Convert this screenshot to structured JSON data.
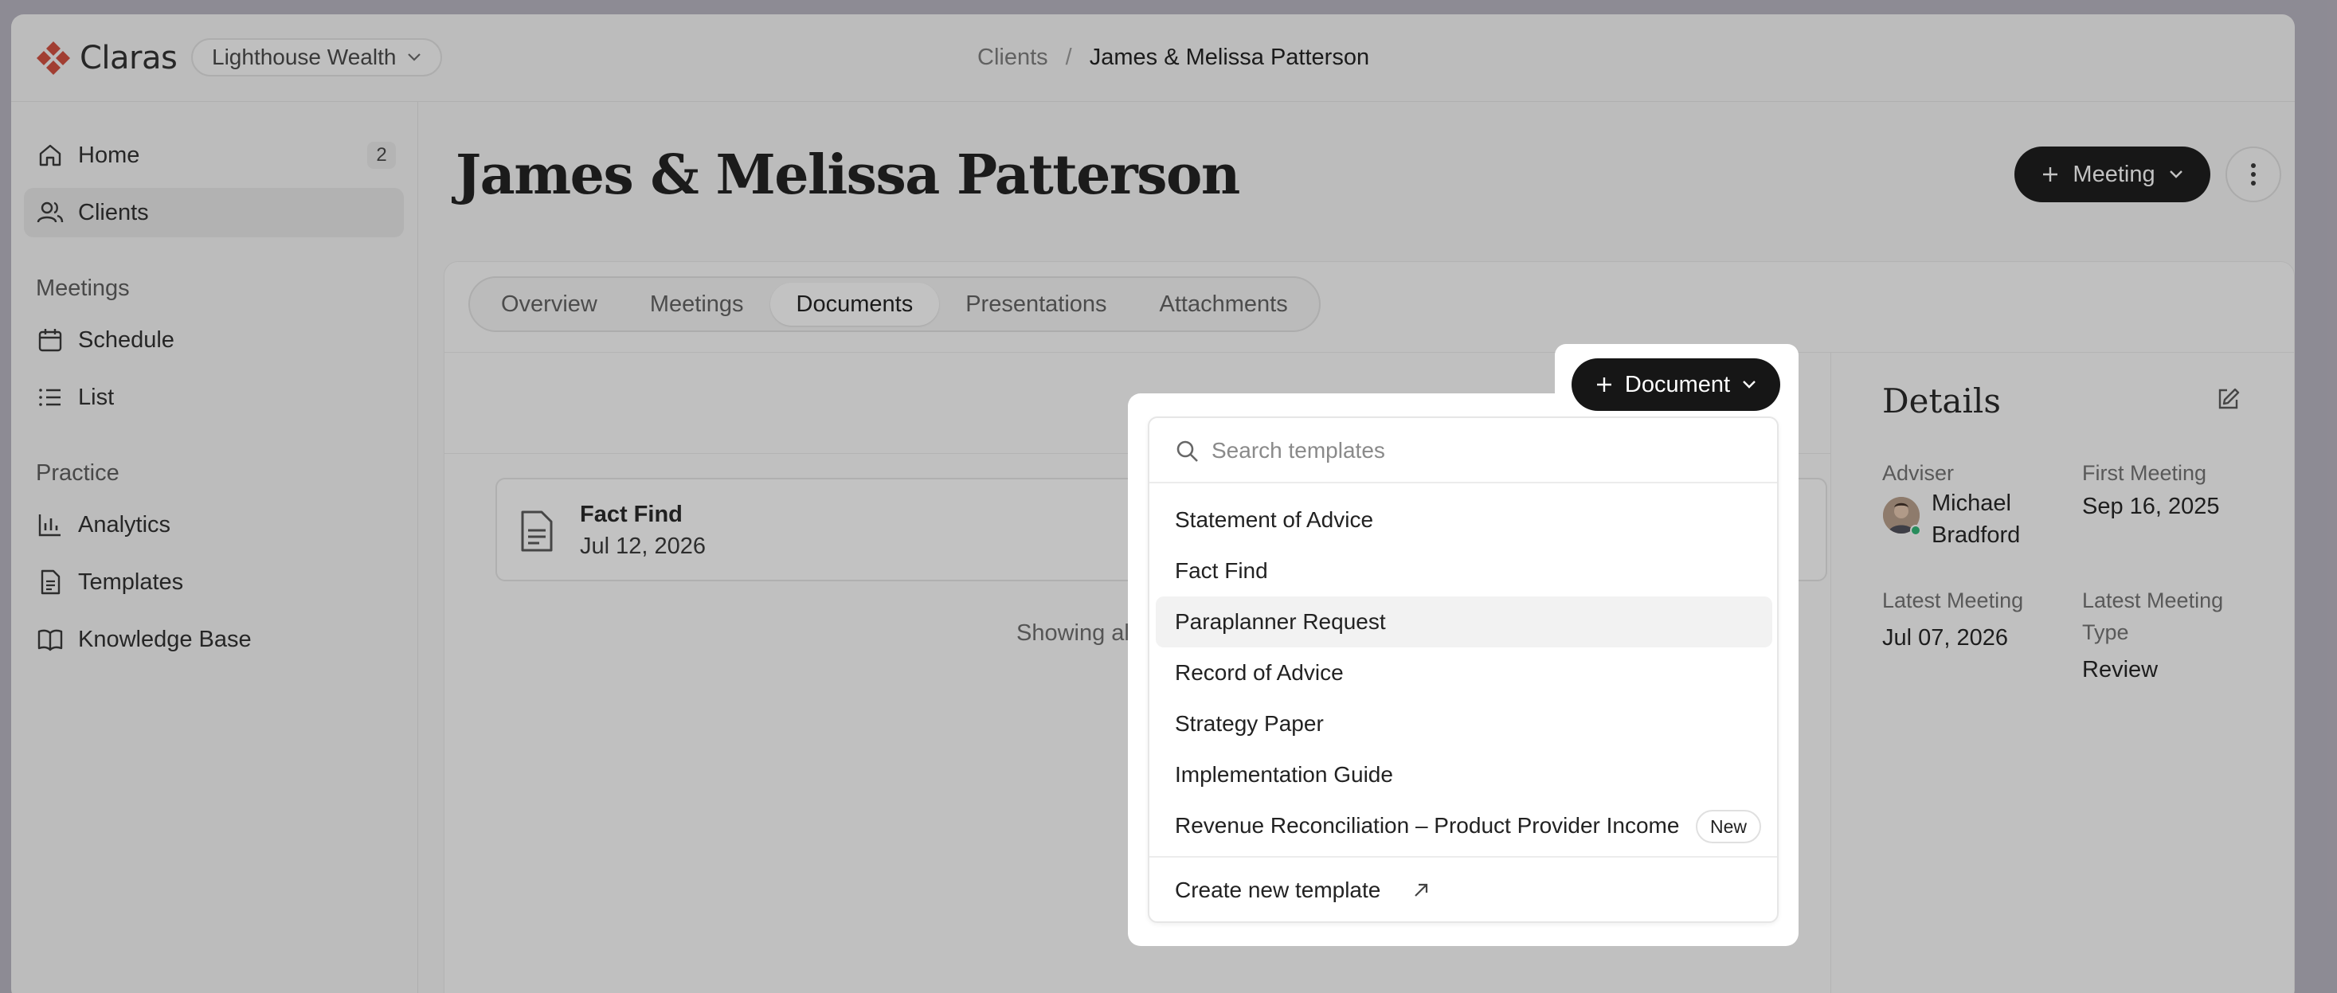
{
  "app": {
    "name": "Claras",
    "org": "Lighthouse Wealth"
  },
  "breadcrumb": {
    "parent": "Clients",
    "separator": "/",
    "current": "James & Melissa Patterson"
  },
  "sidebar": {
    "items": [
      {
        "label": "Home",
        "badge": "2"
      },
      {
        "label": "Clients"
      },
      {
        "label": "Schedule"
      },
      {
        "label": "List"
      },
      {
        "label": "Analytics"
      },
      {
        "label": "Templates"
      },
      {
        "label": "Knowledge Base"
      }
    ],
    "sections": {
      "meetings": "Meetings",
      "practice": "Practice"
    }
  },
  "page": {
    "title": "James & Melissa Patterson",
    "meeting_button": "Meeting",
    "tabs": [
      "Overview",
      "Meetings",
      "Documents",
      "Presentations",
      "Attachments"
    ],
    "active_tab": "Documents"
  },
  "documents": {
    "add_button": "Document",
    "items": [
      {
        "name": "Fact Find",
        "date": "Jul 12, 2026"
      }
    ],
    "footer_text": "Showing all docu"
  },
  "details": {
    "title": "Details",
    "adviser_label": "Adviser",
    "adviser_first": "Michael",
    "adviser_last": "Bradford",
    "first_meeting_label": "First Meeting",
    "first_meeting_value": "Sep 16, 2025",
    "latest_meeting_label": "Latest Meeting",
    "latest_meeting_value": "Jul 07, 2026",
    "latest_type_label_1": "Latest Meeting",
    "latest_type_label_2": "Type",
    "latest_type_value": "Review"
  },
  "template_menu": {
    "search_placeholder": "Search templates",
    "options": [
      "Statement of Advice",
      "Fact Find",
      "Paraplanner Request",
      "Record of Advice",
      "Strategy Paper",
      "Implementation Guide",
      "Revenue Reconciliation – Product Provider Income"
    ],
    "new_badge": "New",
    "create_label": "Create new template"
  },
  "colors": {
    "accent": "#d24a3a",
    "button": "#151515",
    "online": "#2bb673"
  }
}
